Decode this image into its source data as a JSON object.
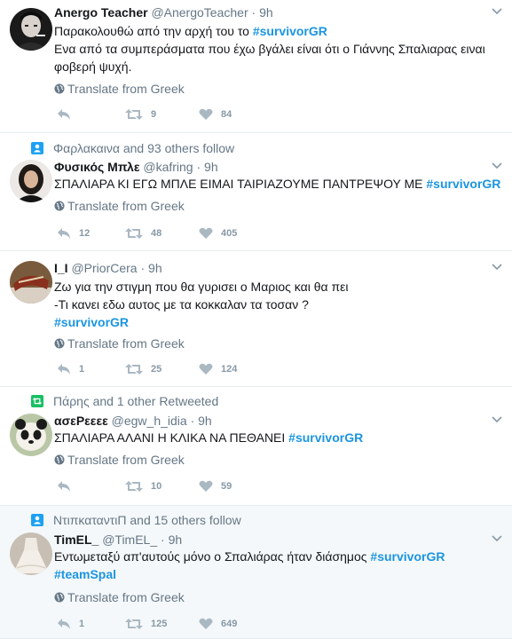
{
  "common": {
    "translate": "Translate from Greek",
    "separator": "·"
  },
  "tweets": [
    {
      "context": "",
      "name": "Anergo Teacher",
      "screen": "@AnergoTeacher",
      "time": "9h",
      "line1": "Παρακολουθώ από την αρχή του το ",
      "tag1": "#survivorGR",
      "line2": "Ενα από τα συμπεράσματα που έχω βγάλει είναι ότι ο Γιάννης Σπαλιαρας ειναι φοβερή ψυχή.",
      "replies": "",
      "retweets": "9",
      "likes": "84"
    },
    {
      "context": "Φαρλακαινα and 93 others follow",
      "name": "Φυσικός Μπλε",
      "screen": "@kafring",
      "time": "9h",
      "line1": "ΣΠΑΛΙΑΡΑ ΚΙ ΕΓΩ ΜΠΛΕ ΕΙΜΑΙ ΤΑΙΡΙΑΖΟΥΜΕ ΠΑΝΤΡΕΨΟΥ ΜΕ ",
      "tag1": "#survivorGR",
      "replies": "12",
      "retweets": "48",
      "likes": "405"
    },
    {
      "context": "",
      "name": "I_I",
      "screen": "@PriorCera",
      "time": "9h",
      "line1": "Ζω για την στιγμη που θα γυρισει ο Μαριος και θα πει",
      "line2": "-Τι κανει εδω αυτος με τα κοκκαλαν τα τοσαν ?",
      "tag1": " #survivorGR",
      "replies": "1",
      "retweets": "25",
      "likes": "124"
    },
    {
      "context": "Πάρης and 1 other Retweeted",
      "name": "ασεΡεεεε",
      "screen": "@egw_h_idia",
      "time": "9h",
      "line1": "ΣΠΑΛΙΑΡΑ ΑΛΑΝΙ Η ΚΛΙΚΑ ΝΑ ΠΕΘΑΝΕΙ  ",
      "tag1": "#survivorGR",
      "replies": "",
      "retweets": "10",
      "likes": "59"
    },
    {
      "context": "ΝτιπκαταντιΠ and 15 others follow",
      "name": "TimEL_",
      "screen": "@TimEL_",
      "time": "9h",
      "line1": "Εντωμεταξύ απ'αυτούς μόνο ο Σπαλιάρας ήταν διάσημος  ",
      "tag1": "#survivorGR",
      "tag2": "#teamSpal",
      "replies": "1",
      "retweets": "125",
      "likes": "649"
    }
  ],
  "icons": {
    "reply": "reply-icon",
    "retweet": "retweet-icon",
    "like": "heart-icon",
    "globe": "globe-icon",
    "caret": "chevron-down-icon"
  },
  "colors": {
    "hashtag": "#1b95e0",
    "secondary": "#657786",
    "action": "#aab8c2",
    "divider": "#e6ecf0",
    "follow_badge": "#1da1f2",
    "retweet_badge": "#17bf63"
  }
}
